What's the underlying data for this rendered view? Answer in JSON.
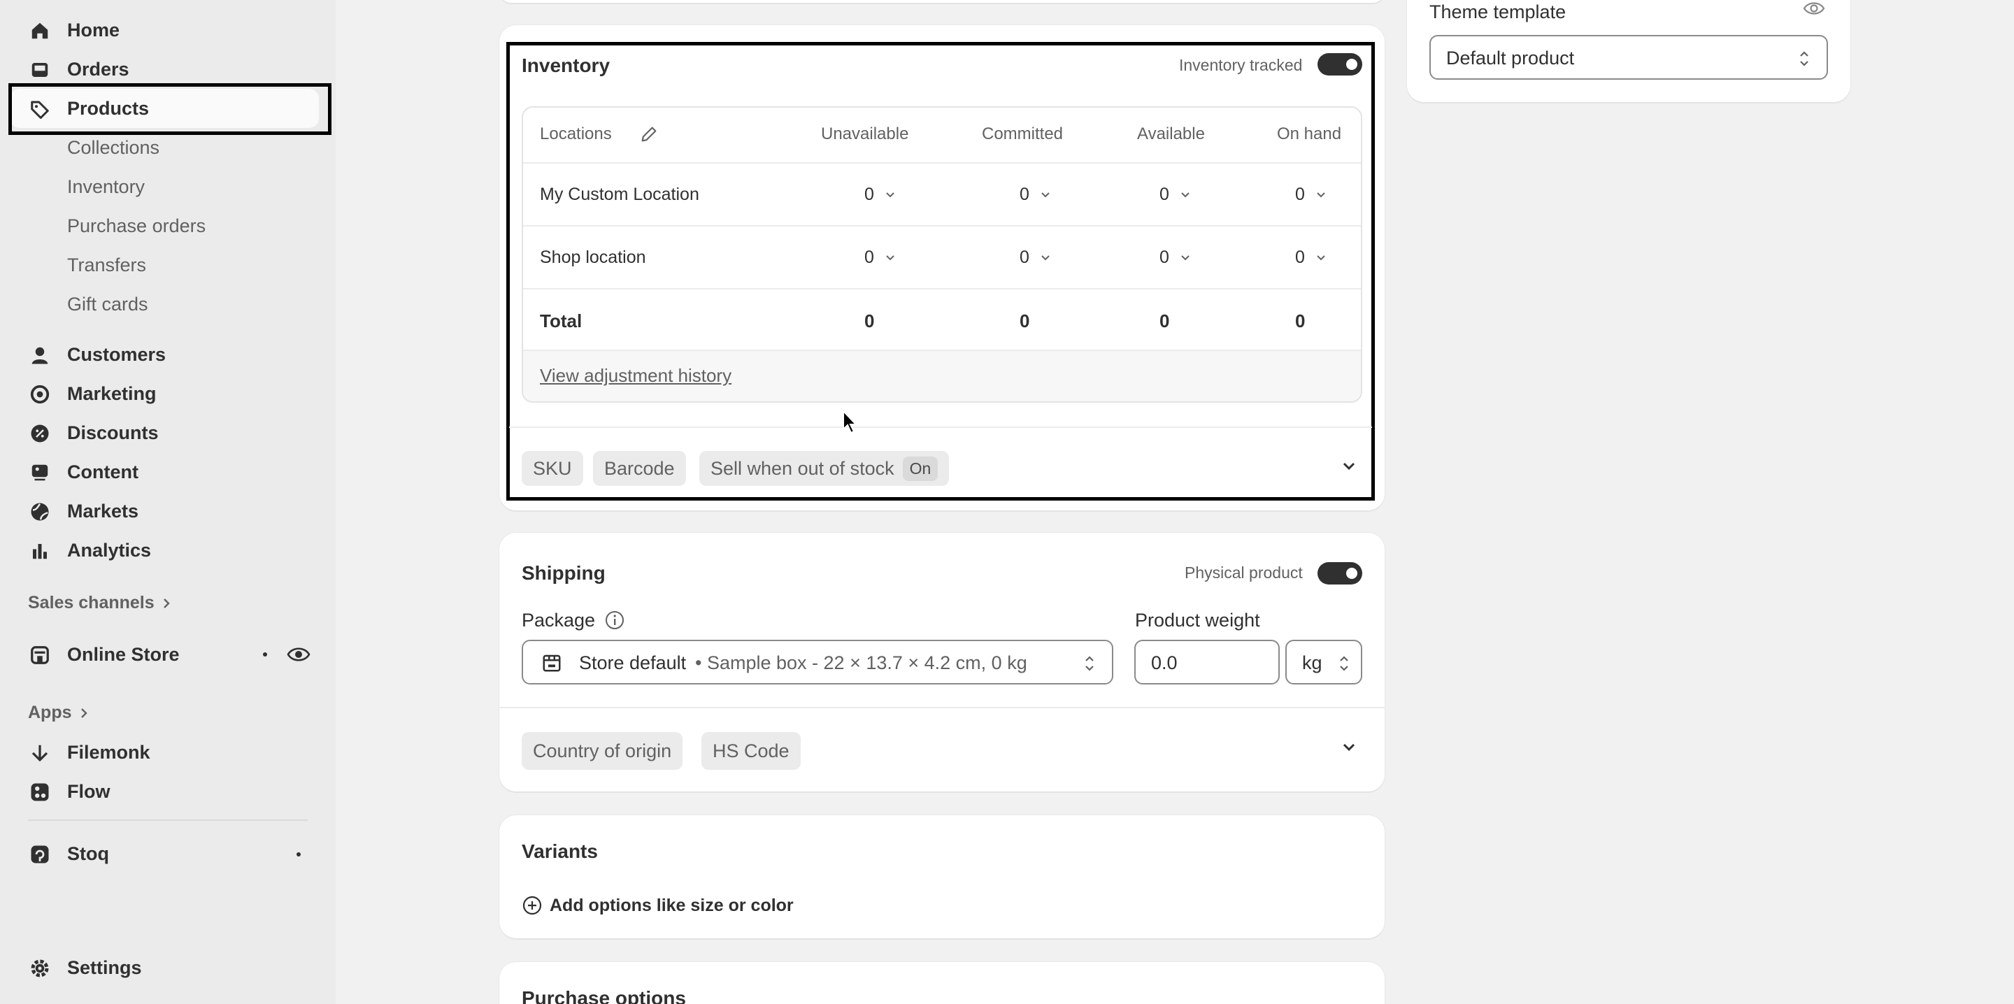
{
  "sidebar": {
    "items": [
      {
        "label": "Home",
        "icon": "home-icon"
      },
      {
        "label": "Orders",
        "icon": "inbox-icon"
      },
      {
        "label": "Products",
        "icon": "tag-icon"
      },
      {
        "label": "Customers",
        "icon": "person-icon"
      },
      {
        "label": "Marketing",
        "icon": "target-icon"
      },
      {
        "label": "Discounts",
        "icon": "discount-icon"
      },
      {
        "label": "Content",
        "icon": "image-icon"
      },
      {
        "label": "Markets",
        "icon": "globe-icon"
      },
      {
        "label": "Analytics",
        "icon": "bar-chart-icon"
      }
    ],
    "product_subitems": [
      "Collections",
      "Inventory",
      "Purchase orders",
      "Transfers",
      "Gift cards"
    ],
    "sales_channels_label": "Sales channels",
    "online_store_label": "Online Store",
    "apps_label": "Apps",
    "apps": [
      "Filemonk",
      "Flow"
    ],
    "stoq_label": "Stoq",
    "settings_label": "Settings"
  },
  "inventory": {
    "title": "Inventory",
    "tracked_label": "Inventory tracked",
    "columns": [
      "Locations",
      "Unavailable",
      "Committed",
      "Available",
      "On hand"
    ],
    "rows": [
      {
        "name": "My Custom Location",
        "values": [
          "0",
          "0",
          "0",
          "0"
        ]
      },
      {
        "name": "Shop location",
        "values": [
          "0",
          "0",
          "0",
          "0"
        ]
      }
    ],
    "total": {
      "label": "Total",
      "values": [
        "0",
        "0",
        "0",
        "0"
      ]
    },
    "history_link": "View adjustment history",
    "chips": {
      "sku": "SKU",
      "barcode": "Barcode",
      "sell_oos": "Sell when out of stock",
      "sell_oos_state": "On"
    }
  },
  "shipping": {
    "title": "Shipping",
    "physical_label": "Physical product",
    "package_label": "Package",
    "package_value_bold": "Store default",
    "package_value_detail": "• Sample box - 22 × 13.7 × 4.2 cm, 0 kg",
    "weight_label": "Product weight",
    "weight_value": "0.0",
    "weight_unit": "kg",
    "chips": {
      "origin": "Country of origin",
      "hs": "HS Code"
    }
  },
  "variants": {
    "title": "Variants",
    "add_label": "Add options like size or color"
  },
  "purchase_options": {
    "title": "Purchase options"
  },
  "theme": {
    "label": "Theme template",
    "value": "Default product"
  }
}
